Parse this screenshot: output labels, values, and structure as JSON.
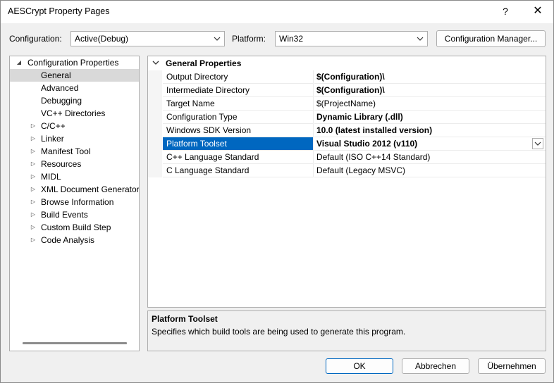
{
  "window": {
    "title": "AESCrypt Property Pages",
    "help_label": "?",
    "close_label": "✕"
  },
  "toolbar": {
    "configuration_label": "Configuration:",
    "configuration_value": "Active(Debug)",
    "platform_label": "Platform:",
    "platform_value": "Win32",
    "config_manager_label": "Configuration Manager..."
  },
  "tree": {
    "root": "Configuration Properties",
    "items": [
      {
        "label": "General",
        "expandable": false,
        "selected": true
      },
      {
        "label": "Advanced",
        "expandable": false
      },
      {
        "label": "Debugging",
        "expandable": false
      },
      {
        "label": "VC++ Directories",
        "expandable": false
      },
      {
        "label": "C/C++",
        "expandable": true
      },
      {
        "label": "Linker",
        "expandable": true
      },
      {
        "label": "Manifest Tool",
        "expandable": true
      },
      {
        "label": "Resources",
        "expandable": true
      },
      {
        "label": "MIDL",
        "expandable": true
      },
      {
        "label": "XML Document Generator",
        "expandable": true
      },
      {
        "label": "Browse Information",
        "expandable": true
      },
      {
        "label": "Build Events",
        "expandable": true
      },
      {
        "label": "Custom Build Step",
        "expandable": true
      },
      {
        "label": "Code Analysis",
        "expandable": true
      }
    ]
  },
  "grid": {
    "section_title": "General Properties",
    "rows": [
      {
        "name": "Output Directory",
        "value": "$(Configuration)\\",
        "bold": true
      },
      {
        "name": "Intermediate Directory",
        "value": "$(Configuration)\\",
        "bold": true
      },
      {
        "name": "Target Name",
        "value": "$(ProjectName)",
        "bold": false
      },
      {
        "name": "Configuration Type",
        "value": "Dynamic Library (.dll)",
        "bold": true
      },
      {
        "name": "Windows SDK Version",
        "value": "10.0 (latest installed version)",
        "bold": true
      },
      {
        "name": "Platform Toolset",
        "value": "Visual Studio 2012 (v110)",
        "bold": true,
        "selected": true
      },
      {
        "name": "C++ Language Standard",
        "value": "Default (ISO C++14 Standard)",
        "bold": false
      },
      {
        "name": "C Language Standard",
        "value": "Default (Legacy MSVC)",
        "bold": false
      }
    ]
  },
  "description": {
    "title": "Platform Toolset",
    "text": "Specifies which build tools are being used to generate this program."
  },
  "buttons": {
    "ok": "OK",
    "cancel": "Abbrechen",
    "apply": "Übernehmen"
  },
  "colors": {
    "selection": "#0067c0",
    "tree_selection": "#d9d9d9"
  }
}
